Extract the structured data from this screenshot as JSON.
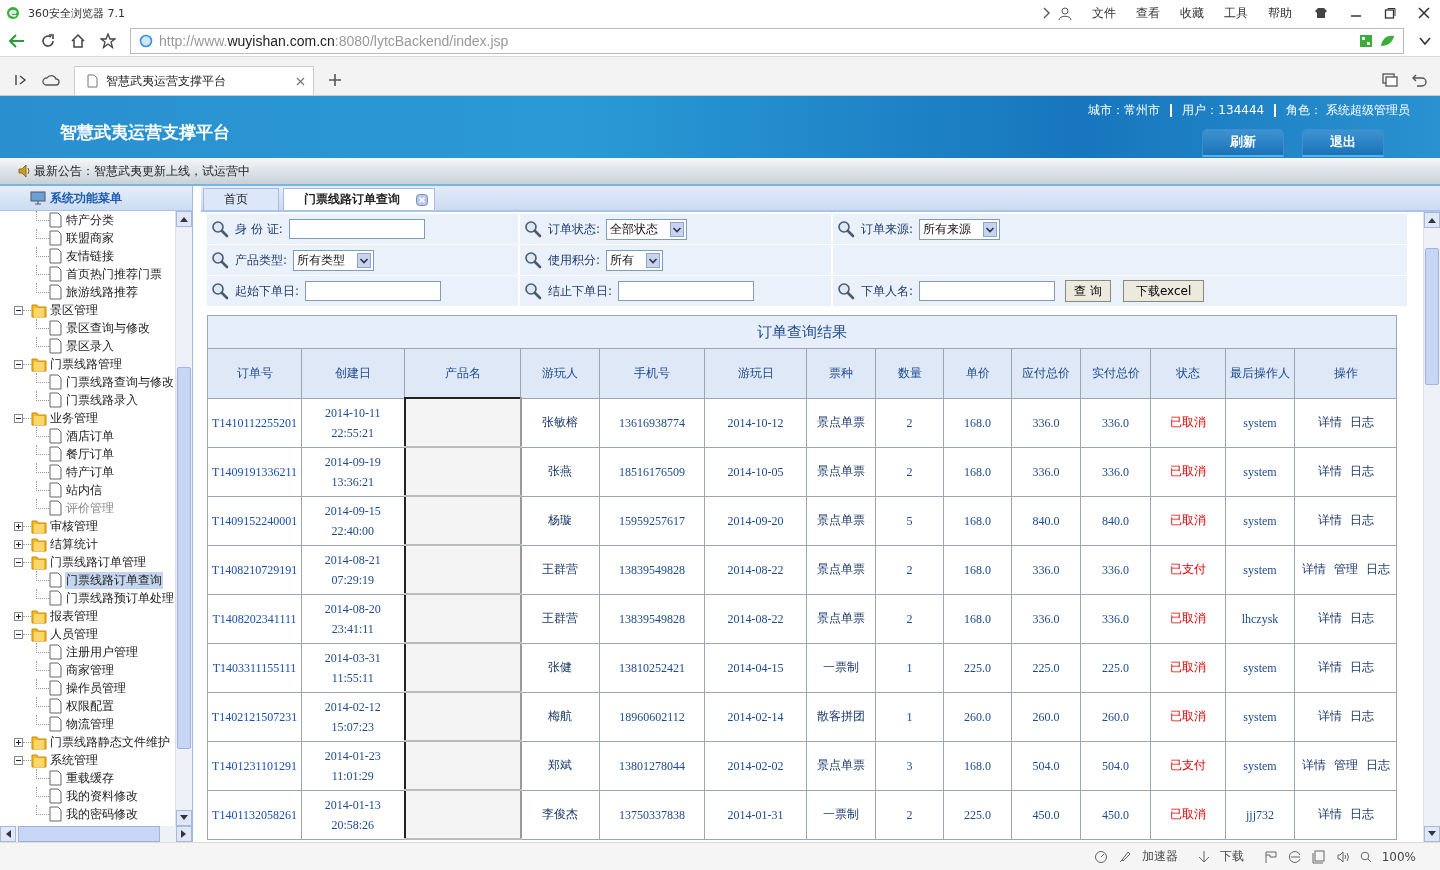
{
  "browser": {
    "title": "360安全浏览器 7.1",
    "menu": [
      "文件",
      "查看",
      "收藏",
      "工具",
      "帮助"
    ],
    "url": {
      "prefix": "http://www.",
      "host": "wuyishan.com.cn",
      "path": ":8080/lytcBackend/index.jsp"
    },
    "tab": "智慧武夷运营支撑平台",
    "status_bar": [
      "加速器",
      "下载",
      "100%"
    ]
  },
  "header": {
    "title": "智慧武夷运营支撑平台",
    "city": "城市：常州市",
    "user": "用户：134444",
    "role": "角色： 系统超级管理员",
    "buttons": [
      "刷新",
      "退出"
    ]
  },
  "notice": "最新公告：智慧武夷更新上线，试运营中",
  "sidebar": {
    "title": "系统功能菜单",
    "tree": [
      {
        "children": [
          {
            "label": "特产分类",
            "selected": false,
            "disabled": false
          },
          {
            "label": "联盟商家",
            "selected": false,
            "disabled": false
          },
          {
            "label": "友情链接",
            "selected": false,
            "disabled": false
          },
          {
            "label": "首页热门推荐门票",
            "selected": false,
            "disabled": false
          },
          {
            "label": "旅游线路推荐",
            "selected": false,
            "disabled": false
          }
        ]
      },
      {
        "label": "景区管理",
        "expanded": true,
        "children": [
          {
            "label": "景区查询与修改",
            "selected": false,
            "disabled": false
          },
          {
            "label": "景区录入",
            "selected": false,
            "disabled": false
          }
        ]
      },
      {
        "label": "门票线路管理",
        "expanded": true,
        "children": [
          {
            "label": "门票线路查询与修改",
            "selected": false,
            "disabled": false
          },
          {
            "label": "门票线路录入",
            "selected": false,
            "disabled": false
          }
        ]
      },
      {
        "label": "业务管理",
        "expanded": true,
        "children": [
          {
            "label": "酒店订单",
            "selected": false,
            "disabled": false
          },
          {
            "label": "餐厅订单",
            "selected": false,
            "disabled": false
          },
          {
            "label": "特产订单",
            "selected": false,
            "disabled": false
          },
          {
            "label": "站内信",
            "selected": false,
            "disabled": false
          },
          {
            "label": "评价管理",
            "selected": false,
            "disabled": true
          }
        ]
      },
      {
        "label": "审核管理",
        "expanded": false
      },
      {
        "label": "结算统计",
        "expanded": false
      },
      {
        "label": "门票线路订单管理",
        "expanded": true,
        "children": [
          {
            "label": "门票线路订单查询",
            "selected": true,
            "disabled": false
          },
          {
            "label": "门票线路预订单处理",
            "selected": false,
            "disabled": false
          }
        ]
      },
      {
        "label": "报表管理",
        "expanded": false
      },
      {
        "label": "人员管理",
        "expanded": true,
        "children": [
          {
            "label": "注册用户管理",
            "selected": false,
            "disabled": false
          },
          {
            "label": "商家管理",
            "selected": false,
            "disabled": false
          },
          {
            "label": "操作员管理",
            "selected": false,
            "disabled": false
          },
          {
            "label": "权限配置",
            "selected": false,
            "disabled": false
          },
          {
            "label": "物流管理",
            "selected": false,
            "disabled": false
          }
        ]
      },
      {
        "label": "门票线路静态文件维护",
        "expanded": false
      },
      {
        "label": "系统管理",
        "expanded": true,
        "children": [
          {
            "label": "重载缓存",
            "selected": false,
            "disabled": false
          },
          {
            "label": "我的资料修改",
            "selected": false,
            "disabled": false
          },
          {
            "label": "我的密码修改",
            "selected": false,
            "disabled": false
          }
        ]
      }
    ]
  },
  "tabs": [
    {
      "label": "首页",
      "selected": false,
      "closable": false
    },
    {
      "label": "门票线路订单查询",
      "selected": true,
      "closable": true
    }
  ],
  "filters": [
    [
      {
        "kind": "text",
        "label": "身 份 证:"
      },
      {
        "kind": "select",
        "label": "订单状态:",
        "value": "全部状态"
      },
      {
        "kind": "select",
        "label": "订单来源:",
        "value": "所有来源"
      }
    ],
    [
      {
        "kind": "select",
        "label": "产品类型:",
        "value": "所有类型"
      },
      {
        "kind": "select",
        "label": "使用积分:",
        "value": "所有"
      }
    ],
    [
      {
        "kind": "text",
        "label": "起始下单日:"
      },
      {
        "kind": "text",
        "label": "结止下单日:"
      },
      {
        "kind": "text",
        "label": "下单人名:"
      }
    ]
  ],
  "filter_buttons": [
    "查 询",
    "下载excel"
  ],
  "table": {
    "title": "订单查询结果",
    "columns": [
      "订单号",
      "创建日",
      "产品名",
      "游玩人",
      "手机号",
      "游玩日",
      "票种",
      "数量",
      "单价",
      "应付总价",
      "实付总价",
      "状态",
      "最后操作人",
      "操作"
    ],
    "rows": [
      {
        "order": "T1410112255201",
        "date": "2014-10-11",
        "time": "22:55:21",
        "visitor": "张敏榕",
        "phone": "13616938774",
        "play_date": "2014-10-12",
        "ticket": "景点单票",
        "qty": "2",
        "price": "168.0",
        "payable": "336.0",
        "paid": "336.0",
        "status": "已取消",
        "operator": "system",
        "actions": [
          "详情",
          "日志"
        ]
      },
      {
        "order": "T1409191336211",
        "date": "2014-09-19",
        "time": "13:36:21",
        "visitor": "张燕",
        "phone": "18516176509",
        "play_date": "2014-10-05",
        "ticket": "景点单票",
        "qty": "2",
        "price": "168.0",
        "payable": "336.0",
        "paid": "336.0",
        "status": "已取消",
        "operator": "system",
        "actions": [
          "详情",
          "日志"
        ]
      },
      {
        "order": "T1409152240001",
        "date": "2014-09-15",
        "time": "22:40:00",
        "visitor": "杨璇",
        "phone": "15959257617",
        "play_date": "2014-09-20",
        "ticket": "景点单票",
        "qty": "5",
        "price": "168.0",
        "payable": "840.0",
        "paid": "840.0",
        "status": "已取消",
        "operator": "system",
        "actions": [
          "详情",
          "日志"
        ]
      },
      {
        "order": "T1408210729191",
        "date": "2014-08-21",
        "time": "07:29:19",
        "visitor": "王群营",
        "phone": "13839549828",
        "play_date": "2014-08-22",
        "ticket": "景点单票",
        "qty": "2",
        "price": "168.0",
        "payable": "336.0",
        "paid": "336.0",
        "status": "已支付",
        "operator": "system",
        "actions": [
          "详情",
          "管理",
          "日志"
        ]
      },
      {
        "order": "T1408202341111",
        "date": "2014-08-20",
        "time": "23:41:11",
        "visitor": "王群营",
        "phone": "13839549828",
        "play_date": "2014-08-22",
        "ticket": "景点单票",
        "qty": "2",
        "price": "168.0",
        "payable": "336.0",
        "paid": "336.0",
        "status": "已取消",
        "operator": "lhczysk",
        "actions": [
          "详情",
          "日志"
        ]
      },
      {
        "order": "T1403311155111",
        "date": "2014-03-31",
        "time": "11:55:11",
        "visitor": "张健",
        "phone": "13810252421",
        "play_date": "2014-04-15",
        "ticket": "一票制",
        "qty": "1",
        "price": "225.0",
        "payable": "225.0",
        "paid": "225.0",
        "status": "已取消",
        "operator": "system",
        "actions": [
          "详情",
          "日志"
        ]
      },
      {
        "order": "T1402121507231",
        "date": "2014-02-12",
        "time": "15:07:23",
        "visitor": "梅航",
        "phone": "18960602112",
        "play_date": "2014-02-14",
        "ticket": "散客拼团",
        "qty": "1",
        "price": "260.0",
        "payable": "260.0",
        "paid": "260.0",
        "status": "已取消",
        "operator": "system",
        "actions": [
          "详情",
          "日志"
        ]
      },
      {
        "order": "T1401231101291",
        "date": "2014-01-23",
        "time": "11:01:29",
        "visitor": "郑斌",
        "phone": "13801278044",
        "play_date": "2014-02-02",
        "ticket": "景点单票",
        "qty": "3",
        "price": "168.0",
        "payable": "504.0",
        "paid": "504.0",
        "status": "已支付",
        "operator": "system",
        "actions": [
          "详情",
          "管理",
          "日志"
        ]
      },
      {
        "order": "T1401132058261",
        "date": "2014-01-13",
        "time": "20:58:26",
        "visitor": "李俊杰",
        "phone": "13750337838",
        "play_date": "2014-01-31",
        "ticket": "一票制",
        "qty": "2",
        "price": "225.0",
        "payable": "450.0",
        "paid": "450.0",
        "status": "已取消",
        "operator": "jjj732",
        "actions": [
          "详情",
          "日志"
        ]
      }
    ]
  }
}
